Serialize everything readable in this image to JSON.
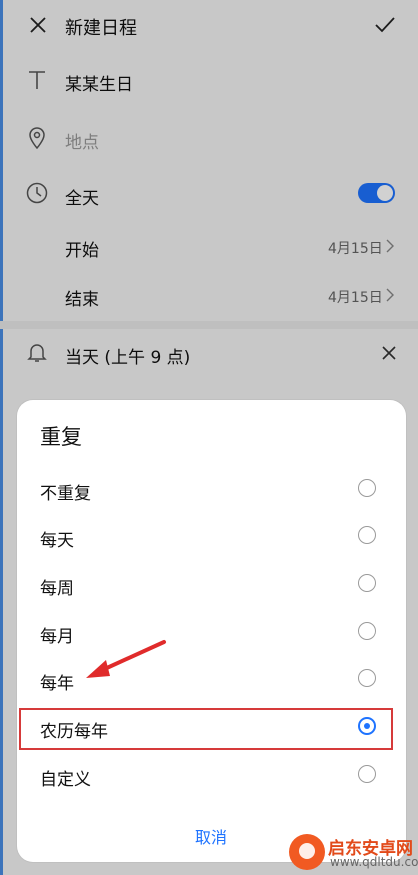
{
  "header": {
    "title": "新建日程"
  },
  "event": {
    "title_value": "某某生日",
    "location_placeholder": "地点",
    "all_day_label": "全天",
    "all_day_on": true,
    "start_label": "开始",
    "start_value": "4月15日",
    "end_label": "结束",
    "end_value": "4月15日",
    "reminder_label": "当天 (上午 9 点)"
  },
  "repeat_dialog": {
    "title": "重复",
    "options": [
      {
        "label": "不重复",
        "selected": false
      },
      {
        "label": "每天",
        "selected": false
      },
      {
        "label": "每周",
        "selected": false
      },
      {
        "label": "每月",
        "selected": false
      },
      {
        "label": "每年",
        "selected": false
      },
      {
        "label": "农历每年",
        "selected": true
      },
      {
        "label": "自定义",
        "selected": false
      }
    ],
    "cancel_label": "取消"
  },
  "watermark": {
    "name": "启东安卓网",
    "url": "www.qdltdu.com"
  },
  "colors": {
    "accent": "#1e73ff",
    "annotation": "#d63a3a"
  }
}
